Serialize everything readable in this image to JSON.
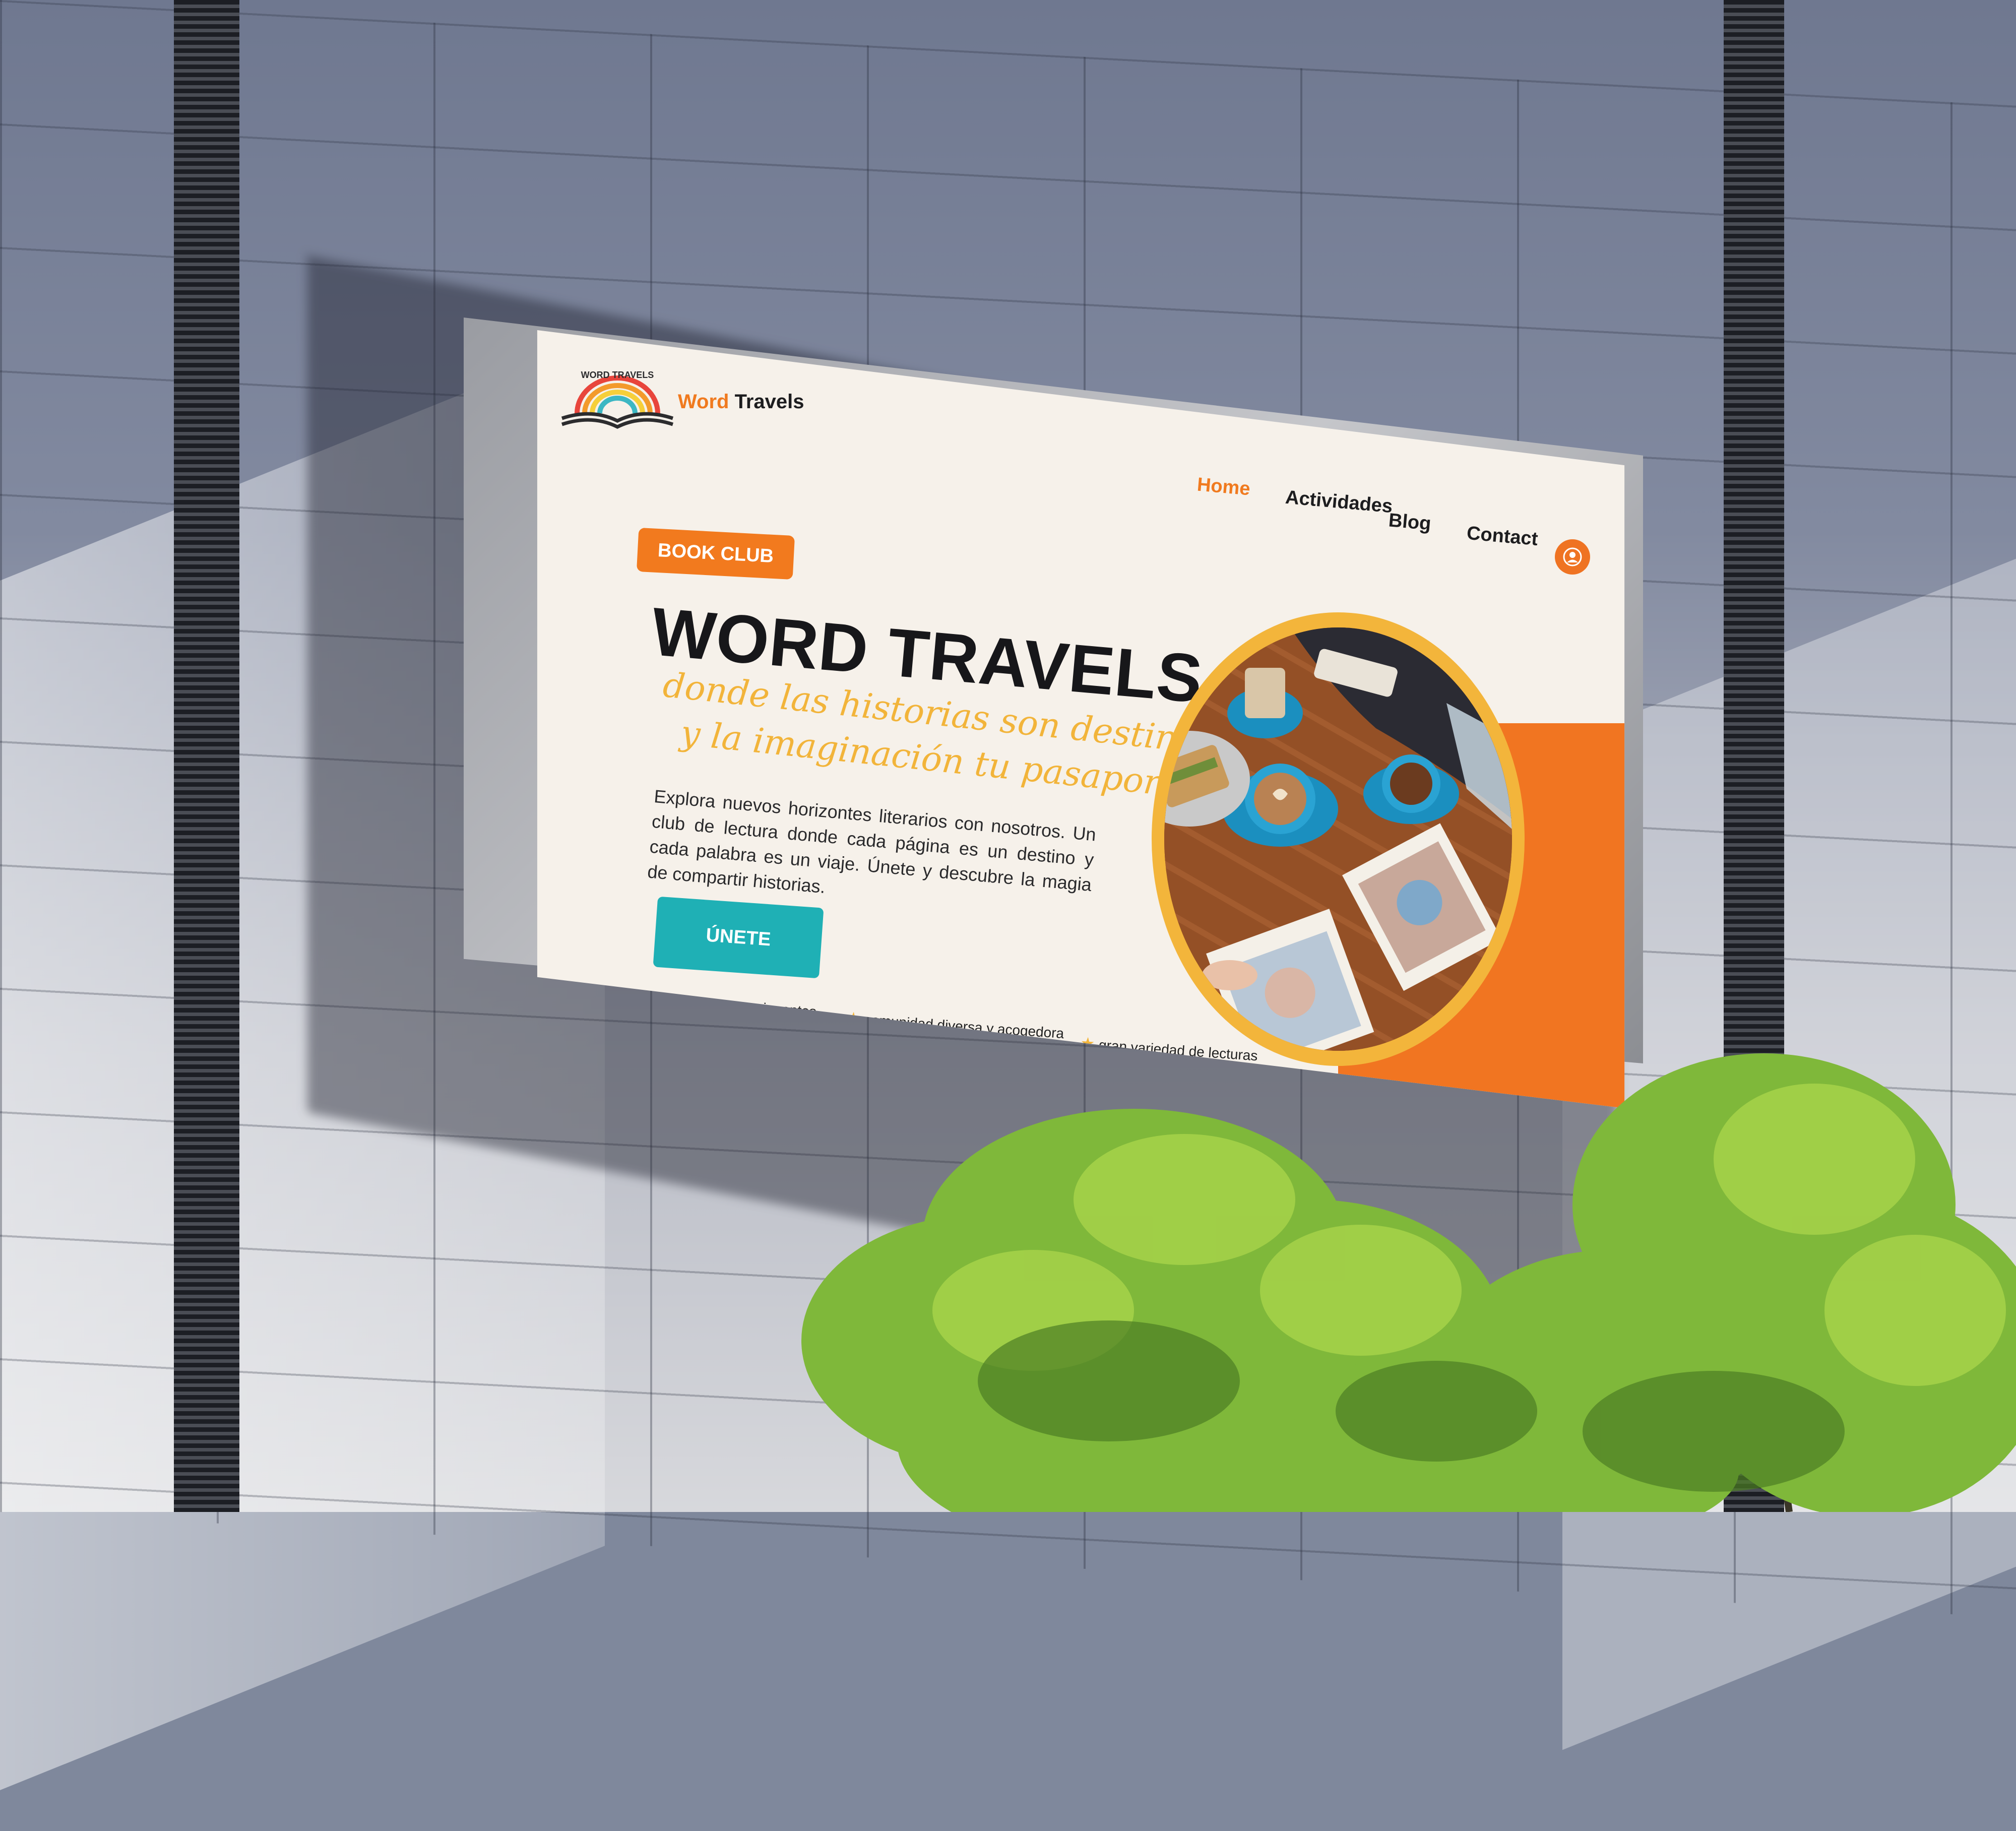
{
  "brand": {
    "name_part1": "Word",
    "name_part2": "Travels",
    "logo_text": "WORD TRAVELS"
  },
  "nav": {
    "items": [
      "Home",
      "Actividades",
      "Blog",
      "Contact"
    ],
    "active": "Home"
  },
  "hero": {
    "tag": "BOOK CLUB",
    "title": "WORD TRAVELS",
    "script_line1": "donde las historias son destinos",
    "script_line2": "y la imaginación tu pasaporte",
    "description": "Explora nuevos horizontes literarios con nosotros. Un club de lectura donde cada página es un destino y cada palabra es un viaje. Únete y descubre la magia de compartir historias.",
    "cta": "ÚNETE"
  },
  "features": [
    "eventos emocionantes",
    "comunidad diversa y acogedora",
    "gran variedad de lecturas"
  ],
  "colors": {
    "accent_orange": "#f27a1e",
    "accent_yellow": "#f3b53b",
    "accent_teal": "#1fb0b5",
    "background": "#f6f1ea"
  },
  "icons": {
    "user": "user-icon",
    "star": "star-icon"
  }
}
